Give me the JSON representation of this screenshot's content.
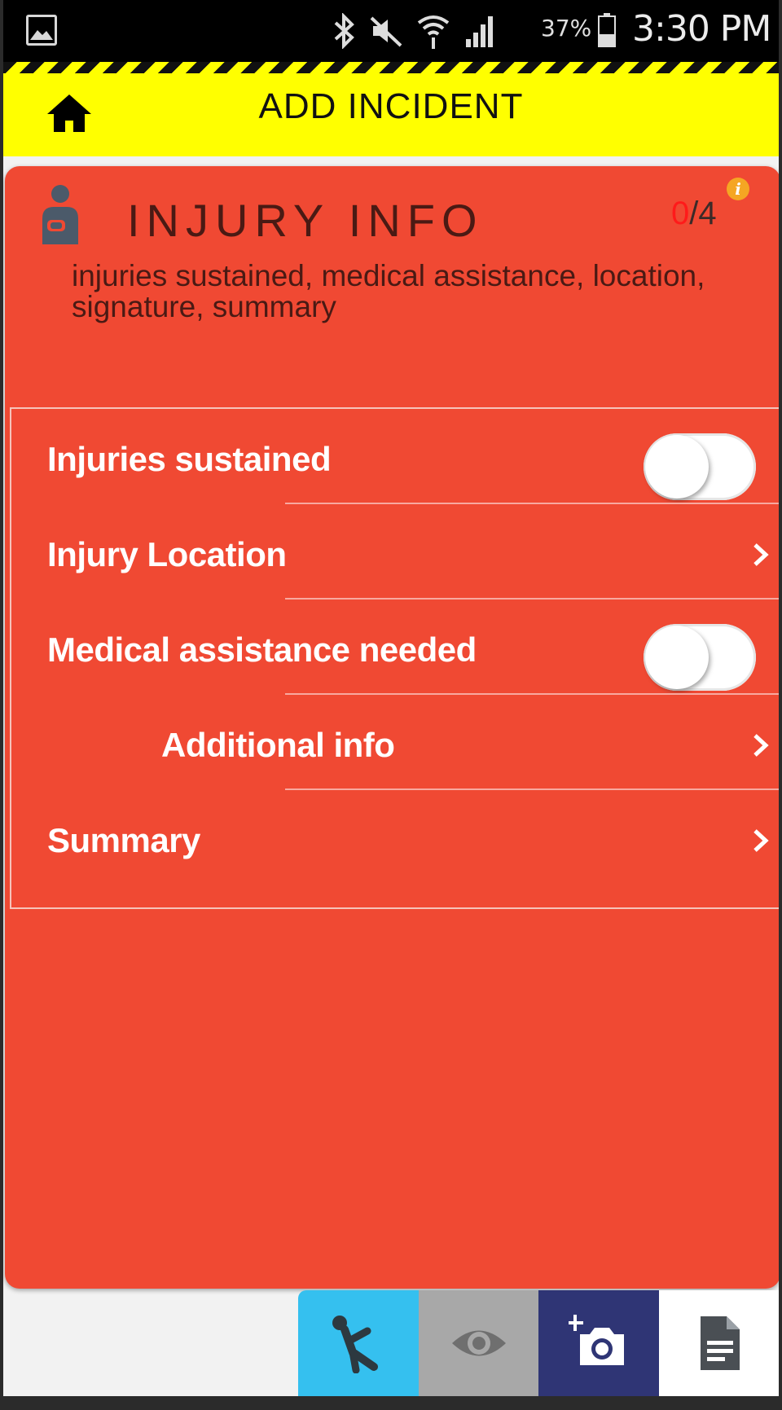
{
  "status_bar": {
    "battery_percent": "37%",
    "time": "3:30 PM"
  },
  "header": {
    "title": "ADD INCIDENT"
  },
  "card": {
    "title": "INJURY INFO",
    "progress_done": "0",
    "progress_total": "/4",
    "description": "injuries sustained,  medical assistance,  location, signature,  summary",
    "rows": [
      {
        "label": "Injuries sustained",
        "control": "toggle",
        "state": "off"
      },
      {
        "label": "Injury Location",
        "control": "chevron"
      },
      {
        "label": "Medical assistance needed",
        "control": "toggle",
        "state": "off"
      },
      {
        "label": "Additional info",
        "control": "chevron"
      },
      {
        "label": "Summary",
        "control": "chevron"
      }
    ]
  },
  "tabs": [
    {
      "icon": "falling-person-icon",
      "color": "#35c0ef"
    },
    {
      "icon": "eye-icon",
      "color": "#a8a8a8"
    },
    {
      "icon": "add-photo-icon",
      "color": "#2f3575"
    },
    {
      "icon": "document-icon",
      "color": "#ffffff"
    }
  ],
  "colors": {
    "header": "#ffff00",
    "card": "#f04933",
    "progress_done": "#ff1a1a"
  }
}
